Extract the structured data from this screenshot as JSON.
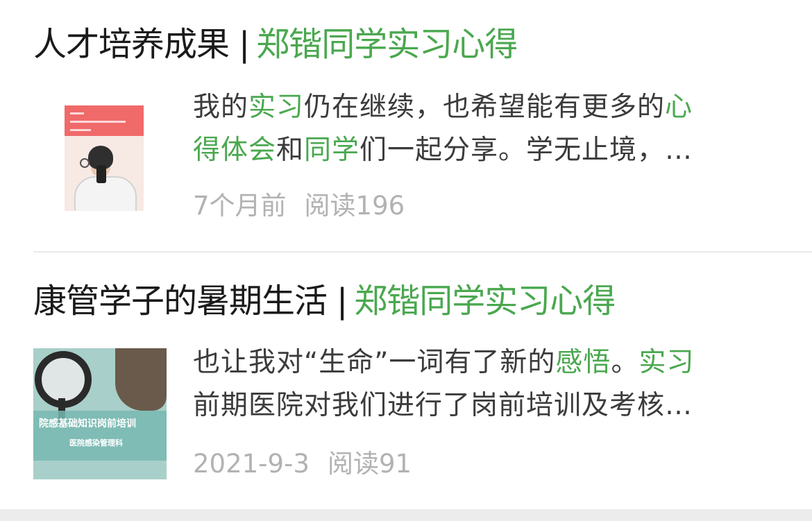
{
  "articles": [
    {
      "title_prefix": "人才培养成果",
      "separator": "|",
      "title_highlight": "郑锴同学实习心得",
      "excerpt_line1": [
        {
          "text": "我的",
          "hl": false
        },
        {
          "text": "实习",
          "hl": true
        },
        {
          "text": "仍在继续，也希望能有更多的",
          "hl": false
        },
        {
          "text": "心",
          "hl": true
        }
      ],
      "excerpt_line2": [
        {
          "text": "得体会",
          "hl": true
        },
        {
          "text": "和",
          "hl": false
        },
        {
          "text": "同学",
          "hl": true
        },
        {
          "text": "们一起分享。学无止境，…",
          "hl": false
        }
      ],
      "time": "7个月前",
      "reads": "阅读196",
      "thumbnail": "student-selfie-photo"
    },
    {
      "title_prefix": "康管学子的暑期生活",
      "separator": "|",
      "title_highlight": "郑锴同学实习心得",
      "excerpt_line1": [
        {
          "text": "也让我对“生命”一词有了新的",
          "hl": false
        },
        {
          "text": "感悟",
          "hl": true
        },
        {
          "text": "。",
          "hl": false
        },
        {
          "text": "实习",
          "hl": true
        }
      ],
      "excerpt_line2": [
        {
          "text": "前期医院对我们进行了岗前培训及考核…",
          "hl": false
        }
      ],
      "time": "2021-9-3",
      "reads": "阅读91",
      "thumbnail": "stethoscope-training-slide",
      "thumb_text1": "院感基础知识岗前培训",
      "thumb_text2": "医院感染管理科"
    }
  ],
  "colors": {
    "highlight": "#4aa84f",
    "title": "#1a1a1a",
    "excerpt": "#3b3b3b",
    "meta": "#b2b2b2"
  }
}
